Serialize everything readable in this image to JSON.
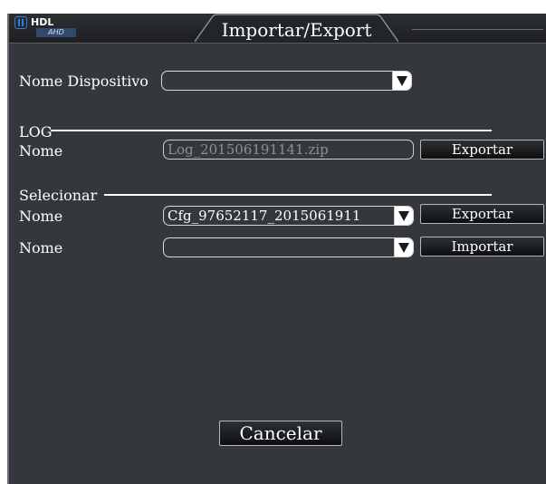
{
  "window": {
    "title": "Importar/Export",
    "logo_brand": "HDL",
    "logo_badge": "AHD"
  },
  "device": {
    "label": "Nome Dispositivo",
    "value": ""
  },
  "log_section": {
    "heading": "LOG",
    "name_label": "Nome",
    "file_value": "Log_201506191141.zip",
    "export_label": "Exportar"
  },
  "select_section": {
    "heading": "Selecionar",
    "export_row": {
      "name_label": "Nome",
      "value": "Cfg_97652117_2015061911",
      "button_label": "Exportar"
    },
    "import_row": {
      "name_label": "Nome",
      "value": "",
      "button_label": "Importar"
    }
  },
  "footer": {
    "cancel_label": "Cancelar"
  },
  "icons": {
    "logo": "hdl-logo-icon",
    "dropdown": "chevron-down-icon"
  },
  "colors": {
    "window_bg": "#34383c",
    "titlebar_bg": "#1d1f22",
    "text": "#ffffff",
    "disabled_text": "#8e9093",
    "logo_accent": "#2f7fd8"
  }
}
